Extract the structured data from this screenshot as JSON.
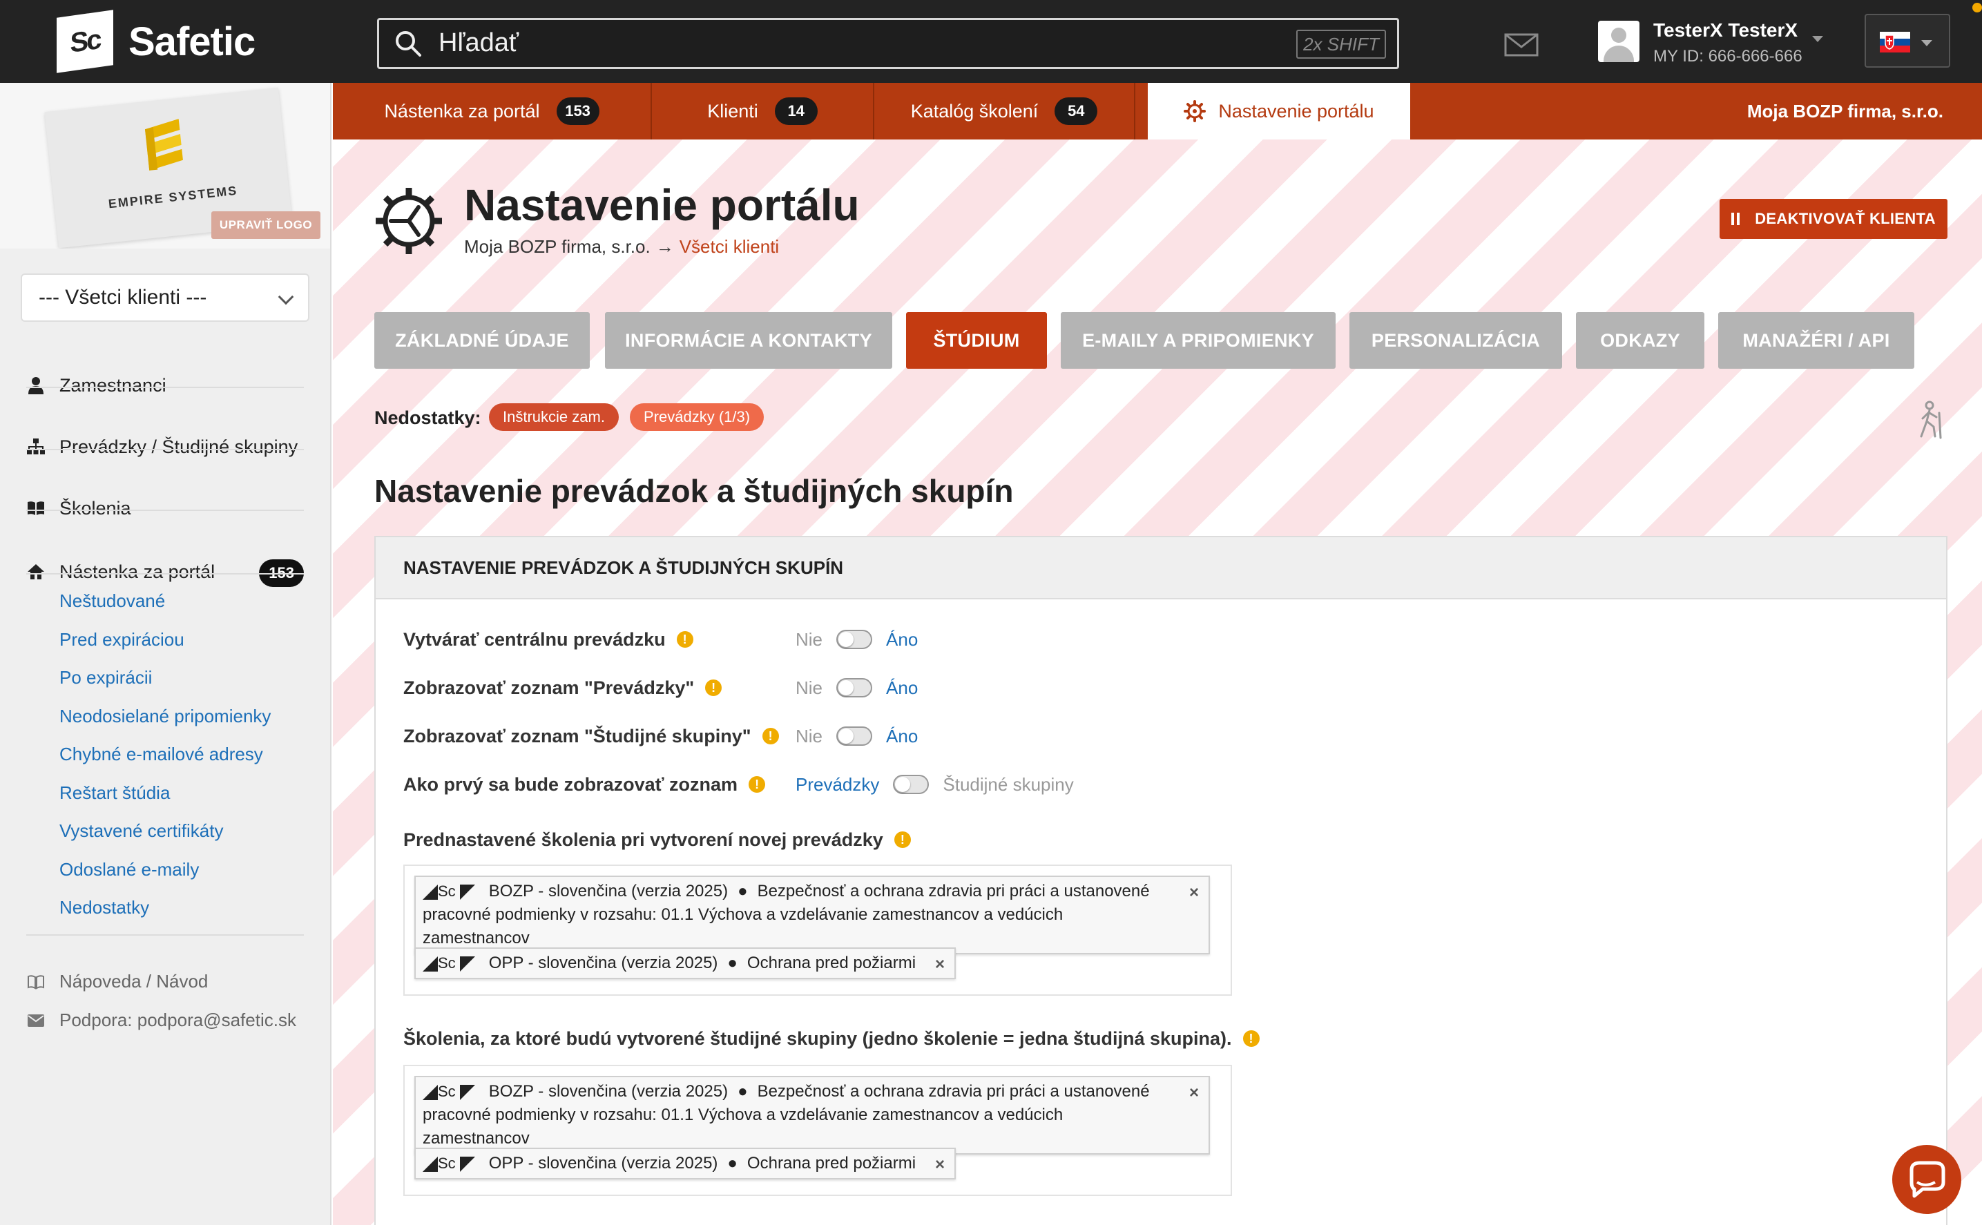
{
  "app": {
    "name": "Safetic",
    "logo_mark": "Sc"
  },
  "search": {
    "placeholder": "Hľadať",
    "shortcut": "2x SHIFT"
  },
  "user": {
    "name": "TesterX TesterX",
    "id_label": "MY ID: 666-666-666"
  },
  "icons": [
    "search-icon",
    "mail-icon",
    "avatar",
    "chevron-down-icon",
    "slovak-flag-icon",
    "person-icon",
    "sitemap-icon",
    "book-icon",
    "home-icon",
    "book-outline-icon",
    "envelope-icon",
    "gear-icon",
    "pause-icon",
    "hiker-icon",
    "warning-icon",
    "close-icon",
    "chat-icon"
  ],
  "sidebar": {
    "logo_brand": "EMPIRE SYSTEMS",
    "edit_logo": "UPRAVIŤ LOGO",
    "client_select": "--- Všetci klienti ---",
    "nav": [
      {
        "label": "Zamestnanci"
      },
      {
        "label": "Prevádzky / Študijné skupiny"
      },
      {
        "label": "Školenia"
      },
      {
        "label": "Nástenka za portál",
        "badge": "153"
      }
    ],
    "subnav": [
      "Neštudované",
      "Pred expiráciou",
      "Po expirácii",
      "Neodosielané pripomienky",
      "Chybné e-mailové adresy",
      "Reštart štúdia",
      "Vystavené certifikáty",
      "Odoslané e-maily",
      "Nedostatky"
    ],
    "help": "Nápoveda / Návod",
    "support_label": "Podpora:",
    "support_email": "podpora@safetic.sk"
  },
  "tabs": [
    {
      "label": "Nástenka za portál",
      "badge": "153"
    },
    {
      "label": "Klienti",
      "badge": "14"
    },
    {
      "label": "Katalóg školení",
      "badge": "54"
    },
    {
      "label": "Nastavenie portálu",
      "active": true
    }
  ],
  "company": "Moja BOZP firma, s.r.o.",
  "page": {
    "title": "Nastavenie portálu",
    "breadcrumb_company": "Moja BOZP firma, s.r.o.",
    "breadcrumb_arrow": "→",
    "breadcrumb_link": "Všetci klienti",
    "deactivate": "DEAKTIVOVAŤ KLIENTA"
  },
  "subtabs": [
    {
      "label": "ZÁKLADNÉ ÚDAJE"
    },
    {
      "label": "INFORMÁCIE A KONTAKTY"
    },
    {
      "label": "ŠTÚDIUM",
      "active": true
    },
    {
      "label": "E-MAILY A PRIPOMIENKY"
    },
    {
      "label": "PERSONALIZÁCIA"
    },
    {
      "label": "ODKAZY"
    },
    {
      "label": "MANAŽÉRI / API"
    }
  ],
  "defects": {
    "label": "Nedostatky:",
    "items": [
      {
        "label": "Inštrukcie zam.",
        "color": "#d14b2c"
      },
      {
        "label": "Prevádzky (1/3)",
        "color": "#ef6a4a"
      }
    ]
  },
  "section_title": "Nastavenie prevádzok a študijných skupín",
  "panel": {
    "header": "NASTAVENIE PREVÁDZOK A ŠTUDIJNÝCH SKUPÍN",
    "settings": [
      {
        "label": "Vytvárať centrálnu prevádzku",
        "off": "Nie",
        "on": "Áno",
        "value": "Áno"
      },
      {
        "label": "Zobrazovať zoznam \"Prevádzky\"",
        "off": "Nie",
        "on": "Áno",
        "value": "Áno"
      },
      {
        "label": "Zobrazovať zoznam \"Študijné skupiny\"",
        "off": "Nie",
        "on": "Áno",
        "value": "Áno"
      },
      {
        "label": "Ako prvý sa bude zobrazovať zoznam",
        "off": "Prevádzky",
        "on": "Študijné skupiny",
        "value": "Prevádzky"
      }
    ],
    "preset_label": "Prednastavené školenia pri vytvorení novej prevádzky",
    "groups_label": "Školenia, za ktoré budú vytvorené študijné skupiny (jedno školenie = jedna študijná skupina).",
    "tag_mark": "Sc",
    "tag_close": "×",
    "tag_dot": "●",
    "tags_preset": [
      {
        "course": "BOZP - slovenčina (verzia 2025)",
        "desc_line1": "Bezpečnosť a ochrana zdravia pri práci a ustanovené",
        "desc_line2": "pracovné podmienky v rozsahu: 01.1 Výchova a vzdelávanie zamestnancov a vedúcich zamestnancov"
      },
      {
        "course": "OPP - slovenčina (verzia 2025)",
        "desc_line1": "Ochrana pred požiarmi"
      }
    ],
    "tags_groups": [
      {
        "course": "BOZP - slovenčina (verzia 2025)",
        "desc_line1": "Bezpečnosť a ochrana zdravia pri práci a ustanovené",
        "desc_line2": "pracovné podmienky v rozsahu: 01.1 Výchova a vzdelávanie zamestnancov a vedúcich zamestnancov"
      },
      {
        "course": "OPP - slovenčina (verzia 2025)",
        "desc_line1": "Ochrana pred požiarmi"
      }
    ]
  },
  "colors": {
    "accent": "#c43b11",
    "tabbar": "#b43a10",
    "link": "#1d6fb8",
    "topbar": "#232323",
    "warning": "#f0ac00"
  }
}
